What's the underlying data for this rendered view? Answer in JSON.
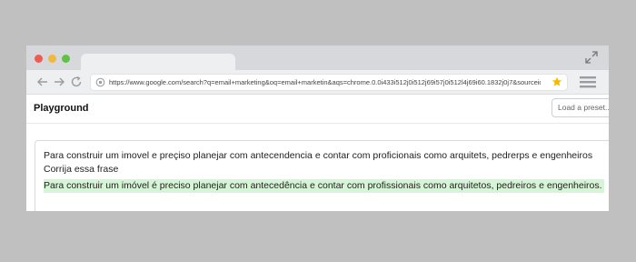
{
  "browser": {
    "url": "https://www.google.com/search?q=email+marketing&oq=email+marketin&aqs=chrome.0.0i433i512j0i512j69i57j0i512l4j69i60.1832j0j7&sourceid..."
  },
  "page": {
    "title": "Playground",
    "preset_label": "Load a preset..."
  },
  "editor": {
    "lines": [
      "Para construir um imovel e preçiso planejar com antecendencia e contar com proficionais como arquitets, pedrerps e engenheiros",
      "Corrija essa frase"
    ],
    "completion": "Para construir um imóvel é preciso planejar com antecedência e contar com profissionais como arquitetos, pedreiros e engenheiros."
  },
  "colors": {
    "completion_highlight": "#d6f5d6",
    "star": "#f5b800"
  }
}
